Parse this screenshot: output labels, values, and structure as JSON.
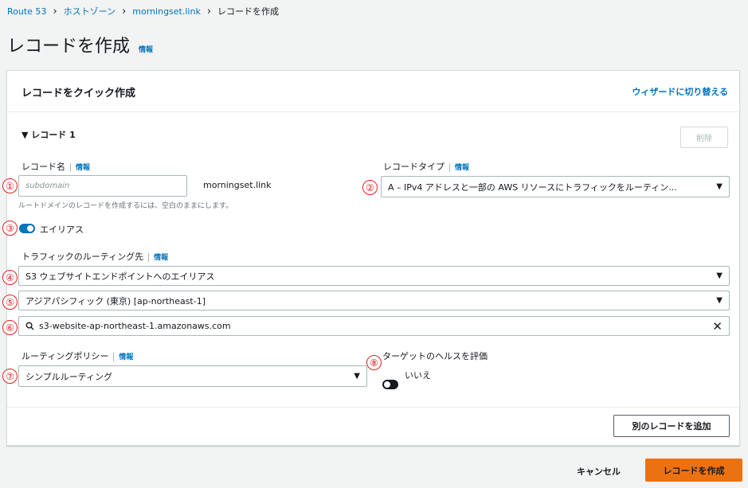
{
  "breadcrumb": {
    "items": [
      "Route 53",
      "ホストゾーン",
      "morningset.link"
    ],
    "current": "レコードを作成"
  },
  "page": {
    "title": "レコードを作成",
    "info": "情報"
  },
  "panel": {
    "title": "レコードをクイック作成",
    "wizard_link": "ウィザードに切り替える",
    "record_section": "▼ レコード 1",
    "delete_button": "削除"
  },
  "record_name": {
    "label": "レコード名",
    "info": "情報",
    "placeholder": "subdomain",
    "suffix": "morningset.link",
    "hint": "ルートドメインのレコードを作成するには、空白のままにします。"
  },
  "record_type": {
    "label": "レコードタイプ",
    "info": "情報",
    "value": "A – IPv4 アドレスと一部の AWS リソースにトラフィックをルーティン..."
  },
  "alias": {
    "label": "エイリアス",
    "on": true
  },
  "routing_target": {
    "label": "トラフィックのルーティング先",
    "info": "情報",
    "endpoint": "S3 ウェブサイトエンドポイントへのエイリアス",
    "region": "アジアパシフィック (東京) [ap-northeast-1]",
    "search_value": "s3-website-ap-northeast-1.amazonaws.com"
  },
  "routing_policy": {
    "label": "ルーティングポリシー",
    "info": "情報",
    "value": "シンプルルーティング"
  },
  "health": {
    "label": "ターゲットのヘルスを評価",
    "value": "いいえ",
    "on": false
  },
  "add_record_button": "別のレコードを追加",
  "footer": {
    "cancel": "キャンセル",
    "create": "レコードを作成"
  },
  "markers": [
    "①",
    "②",
    "③",
    "④",
    "⑤",
    "⑥",
    "⑦",
    "⑧"
  ],
  "colors": {
    "accent": "#0073bb",
    "primary": "#ec7211",
    "marker": "#e02020",
    "toggle_on": "#0073bb",
    "toggle_off": "#16191f"
  }
}
